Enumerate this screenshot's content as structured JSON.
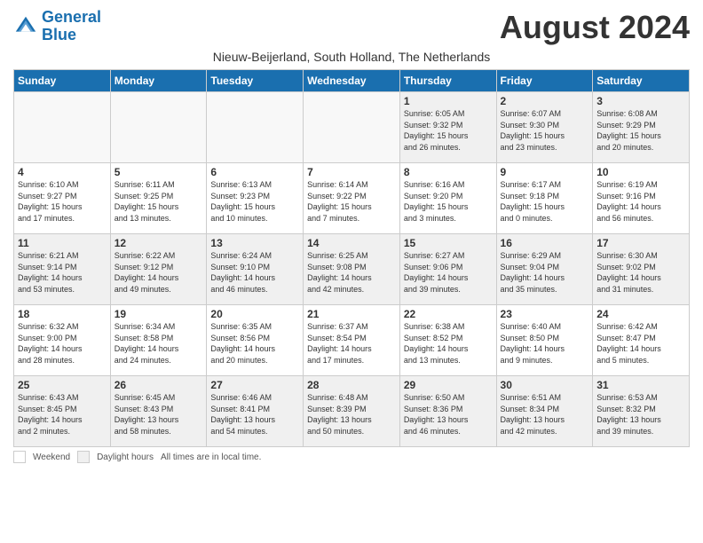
{
  "header": {
    "logo_line1": "General",
    "logo_line2": "Blue",
    "month_title": "August 2024",
    "subtitle": "Nieuw-Beijerland, South Holland, The Netherlands"
  },
  "weekdays": [
    "Sunday",
    "Monday",
    "Tuesday",
    "Wednesday",
    "Thursday",
    "Friday",
    "Saturday"
  ],
  "weeks": [
    [
      {
        "day": "",
        "info": ""
      },
      {
        "day": "",
        "info": ""
      },
      {
        "day": "",
        "info": ""
      },
      {
        "day": "",
        "info": ""
      },
      {
        "day": "1",
        "info": "Sunrise: 6:05 AM\nSunset: 9:32 PM\nDaylight: 15 hours\nand 26 minutes."
      },
      {
        "day": "2",
        "info": "Sunrise: 6:07 AM\nSunset: 9:30 PM\nDaylight: 15 hours\nand 23 minutes."
      },
      {
        "day": "3",
        "info": "Sunrise: 6:08 AM\nSunset: 9:29 PM\nDaylight: 15 hours\nand 20 minutes."
      }
    ],
    [
      {
        "day": "4",
        "info": "Sunrise: 6:10 AM\nSunset: 9:27 PM\nDaylight: 15 hours\nand 17 minutes."
      },
      {
        "day": "5",
        "info": "Sunrise: 6:11 AM\nSunset: 9:25 PM\nDaylight: 15 hours\nand 13 minutes."
      },
      {
        "day": "6",
        "info": "Sunrise: 6:13 AM\nSunset: 9:23 PM\nDaylight: 15 hours\nand 10 minutes."
      },
      {
        "day": "7",
        "info": "Sunrise: 6:14 AM\nSunset: 9:22 PM\nDaylight: 15 hours\nand 7 minutes."
      },
      {
        "day": "8",
        "info": "Sunrise: 6:16 AM\nSunset: 9:20 PM\nDaylight: 15 hours\nand 3 minutes."
      },
      {
        "day": "9",
        "info": "Sunrise: 6:17 AM\nSunset: 9:18 PM\nDaylight: 15 hours\nand 0 minutes."
      },
      {
        "day": "10",
        "info": "Sunrise: 6:19 AM\nSunset: 9:16 PM\nDaylight: 14 hours\nand 56 minutes."
      }
    ],
    [
      {
        "day": "11",
        "info": "Sunrise: 6:21 AM\nSunset: 9:14 PM\nDaylight: 14 hours\nand 53 minutes."
      },
      {
        "day": "12",
        "info": "Sunrise: 6:22 AM\nSunset: 9:12 PM\nDaylight: 14 hours\nand 49 minutes."
      },
      {
        "day": "13",
        "info": "Sunrise: 6:24 AM\nSunset: 9:10 PM\nDaylight: 14 hours\nand 46 minutes."
      },
      {
        "day": "14",
        "info": "Sunrise: 6:25 AM\nSunset: 9:08 PM\nDaylight: 14 hours\nand 42 minutes."
      },
      {
        "day": "15",
        "info": "Sunrise: 6:27 AM\nSunset: 9:06 PM\nDaylight: 14 hours\nand 39 minutes."
      },
      {
        "day": "16",
        "info": "Sunrise: 6:29 AM\nSunset: 9:04 PM\nDaylight: 14 hours\nand 35 minutes."
      },
      {
        "day": "17",
        "info": "Sunrise: 6:30 AM\nSunset: 9:02 PM\nDaylight: 14 hours\nand 31 minutes."
      }
    ],
    [
      {
        "day": "18",
        "info": "Sunrise: 6:32 AM\nSunset: 9:00 PM\nDaylight: 14 hours\nand 28 minutes."
      },
      {
        "day": "19",
        "info": "Sunrise: 6:34 AM\nSunset: 8:58 PM\nDaylight: 14 hours\nand 24 minutes."
      },
      {
        "day": "20",
        "info": "Sunrise: 6:35 AM\nSunset: 8:56 PM\nDaylight: 14 hours\nand 20 minutes."
      },
      {
        "day": "21",
        "info": "Sunrise: 6:37 AM\nSunset: 8:54 PM\nDaylight: 14 hours\nand 17 minutes."
      },
      {
        "day": "22",
        "info": "Sunrise: 6:38 AM\nSunset: 8:52 PM\nDaylight: 14 hours\nand 13 minutes."
      },
      {
        "day": "23",
        "info": "Sunrise: 6:40 AM\nSunset: 8:50 PM\nDaylight: 14 hours\nand 9 minutes."
      },
      {
        "day": "24",
        "info": "Sunrise: 6:42 AM\nSunset: 8:47 PM\nDaylight: 14 hours\nand 5 minutes."
      }
    ],
    [
      {
        "day": "25",
        "info": "Sunrise: 6:43 AM\nSunset: 8:45 PM\nDaylight: 14 hours\nand 2 minutes."
      },
      {
        "day": "26",
        "info": "Sunrise: 6:45 AM\nSunset: 8:43 PM\nDaylight: 13 hours\nand 58 minutes."
      },
      {
        "day": "27",
        "info": "Sunrise: 6:46 AM\nSunset: 8:41 PM\nDaylight: 13 hours\nand 54 minutes."
      },
      {
        "day": "28",
        "info": "Sunrise: 6:48 AM\nSunset: 8:39 PM\nDaylight: 13 hours\nand 50 minutes."
      },
      {
        "day": "29",
        "info": "Sunrise: 6:50 AM\nSunset: 8:36 PM\nDaylight: 13 hours\nand 46 minutes."
      },
      {
        "day": "30",
        "info": "Sunrise: 6:51 AM\nSunset: 8:34 PM\nDaylight: 13 hours\nand 42 minutes."
      },
      {
        "day": "31",
        "info": "Sunrise: 6:53 AM\nSunset: 8:32 PM\nDaylight: 13 hours\nand 39 minutes."
      }
    ]
  ],
  "legend": {
    "white_label": "Weekend",
    "gray_label": "Daylight hours",
    "note": "All times are in local time."
  }
}
